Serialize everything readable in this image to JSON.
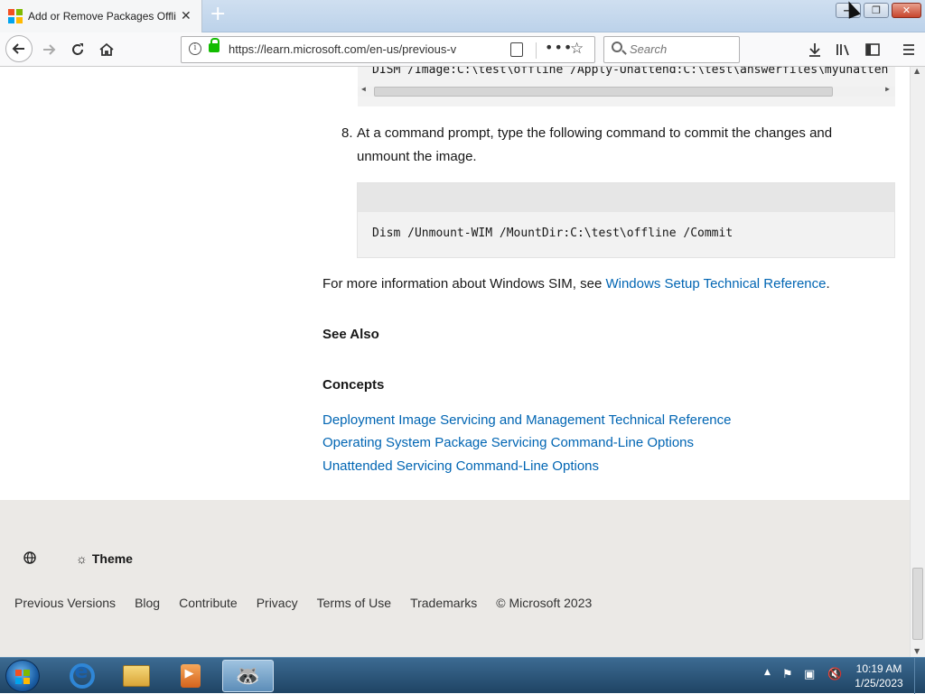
{
  "browser": {
    "tab_title": "Add or Remove Packages Offlin",
    "url": "https://learn.microsoft.com/en-us/previous-v",
    "search_placeholder": "Search",
    "new_tab_glyph": "+",
    "tab_close_glyph": "✕"
  },
  "window_controls": {
    "minimize": "—",
    "maximize": "❐",
    "close": "✕"
  },
  "content": {
    "code_line_1": "DISM /Image:C:\\test\\offline /Apply-Unattend:C:\\test\\answerfiles\\myunatten",
    "step_number": "8.",
    "step_text": "At a command prompt, type the following command to commit the changes and unmount the image.",
    "code_line_2": "Dism /Unmount-WIM /MountDir:C:\\test\\offline /Commit",
    "more_info_prefix": "For more information about Windows SIM, see ",
    "more_info_link": "Windows Setup Technical Reference",
    "more_info_suffix": ".",
    "see_also_heading": "See Also",
    "concepts_heading": "Concepts",
    "concept_links": [
      "Deployment Image Servicing and Management Technical Reference",
      "Operating System Package Servicing Command-Line Options",
      "Unattended Servicing Command-Line Options"
    ]
  },
  "footer": {
    "theme_label": "Theme",
    "links": [
      "Previous Versions",
      "Blog",
      "Contribute",
      "Privacy",
      "Terms of Use",
      "Trademarks",
      "© Microsoft 2023"
    ]
  },
  "taskbar": {
    "time": "10:19 AM",
    "date": "1/25/2023"
  },
  "colors": {
    "link": "#0065b3",
    "footer_bg": "#ebe9e6",
    "code_bg": "#f2f2f2"
  },
  "icons": {
    "tab_favicon": "microsoft-logo-icon",
    "back": "back-arrow-icon",
    "forward": "forward-arrow-icon",
    "reload": "reload-icon",
    "home": "home-icon",
    "info": "info-icon",
    "lock": "lock-icon",
    "reader": "reader-view-icon",
    "page_actions": "more-icon",
    "bookmark": "star-icon",
    "search": "search-icon",
    "downloads": "download-icon",
    "library": "library-icon",
    "sidebar": "sidebar-icon",
    "menu": "hamburger-menu-icon",
    "globe": "globe-icon",
    "theme": "sun-icon"
  }
}
